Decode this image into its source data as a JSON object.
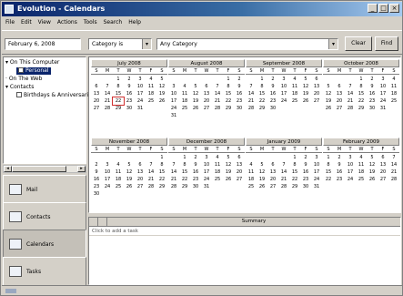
{
  "window": {
    "title": "Evolution - Calendars"
  },
  "menubar": {
    "items": [
      "File",
      "Edit",
      "View",
      "Actions",
      "Tools",
      "Search",
      "Help"
    ]
  },
  "toolbar": {
    "date_field": "February 6, 2008",
    "category_label": "Category is",
    "category_value": "Any Category",
    "clear_label": "Clear",
    "find_label": "Find"
  },
  "tree": {
    "items": [
      {
        "label": "On This Computer"
      },
      {
        "label": "Personal"
      },
      {
        "label": "On The Web"
      },
      {
        "label": "Contacts"
      },
      {
        "label": "Birthdays & Anniversaries"
      }
    ]
  },
  "nav": {
    "buttons": [
      {
        "label": "Mail"
      },
      {
        "label": "Contacts"
      },
      {
        "label": "Calendars"
      },
      {
        "label": "Tasks"
      }
    ]
  },
  "calendar": {
    "dow": [
      "S",
      "M",
      "T",
      "W",
      "T",
      "F",
      "S"
    ],
    "months": [
      {
        "name": "July 2008",
        "start": 2,
        "days": 31
      },
      {
        "name": "August 2008",
        "start": 5,
        "days": 31
      },
      {
        "name": "September 2008",
        "start": 1,
        "days": 30
      },
      {
        "name": "October 2008",
        "start": 3,
        "days": 31
      },
      {
        "name": "November 2008",
        "start": 6,
        "days": 30
      },
      {
        "name": "December 2008",
        "start": 1,
        "days": 31
      },
      {
        "name": "January 2009",
        "start": 4,
        "days": 31
      },
      {
        "name": "February 2009",
        "start": 0,
        "days": 28
      }
    ],
    "highlight": {
      "month": 0,
      "day": 22
    }
  },
  "tasks": {
    "columns": [
      "",
      "",
      "Summary"
    ],
    "new_task_placeholder": "Click to add a task"
  },
  "colors": {
    "title_gradient_start": "#0a246a",
    "selection": "#0a246a",
    "today_marker": "#d03030"
  }
}
